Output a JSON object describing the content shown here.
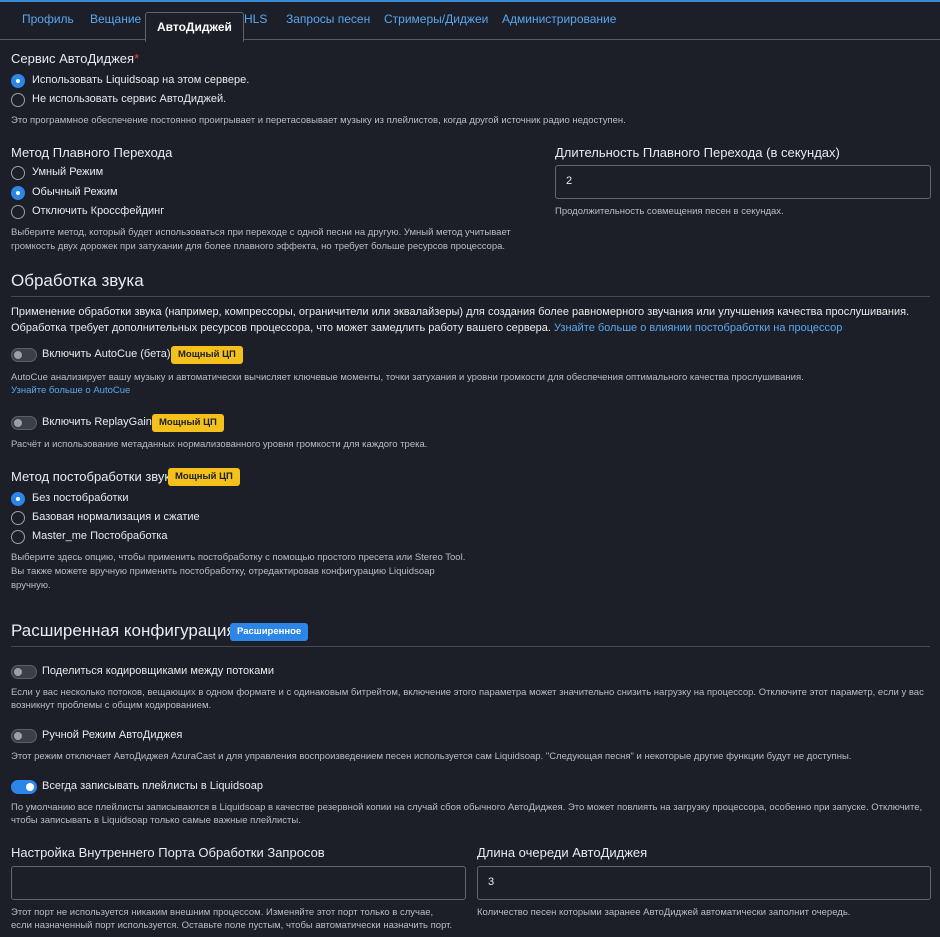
{
  "tabs": [
    "Профиль",
    "Вещание",
    "АвтоДиджей",
    "HLS",
    "Запросы песен",
    "Стримеры/Диджеи",
    "Администрирование"
  ],
  "autodj_service": {
    "label": "Сервис АвтоДиджея",
    "required_mark": "*",
    "options": [
      "Использовать Liquidsoap на этом сервере.",
      "Не использовать сервис АвтоДиджей."
    ],
    "selected": 0,
    "help": "Это программное обеспечение постоянно проигрывает и перетасовывает музыку из плейлистов, когда другой источник радио недоступен."
  },
  "crossfade_method": {
    "label": "Метод Плавного Перехода",
    "options": [
      "Умный Режим",
      "Обычный Режим",
      "Отключить Кроссфейдинг"
    ],
    "selected": 1,
    "help_line1": "Выберите метод, который будет использоваться при переходе с одной песни на другую. Умный метод учитывает",
    "help_line2": "громкость двух дорожек при затухании для более плавного эффекта, но требует больше ресурсов процессора."
  },
  "crossfade_duration": {
    "label": "Длительность Плавного Перехода (в секундах)",
    "value": "2",
    "help": "Продолжительность совмещения песен в секундах."
  },
  "audio_processing": {
    "heading": "Обработка звука",
    "intro_line1": "Применение обработки звука (например, компрессоры, ограничители или эквалайзеры) для создания более равномерного звучания или улучшения качества прослушивания.",
    "intro_line2": "Обработка требует дополнительных ресурсов процессора, что может замедлить работу вашего сервера.",
    "intro_link": "Узнайте больше о влиянии постобработки на процессор",
    "autocue": {
      "label": "Включить AutoCue (бета)",
      "badge": "Мощный ЦП",
      "enabled": false,
      "help": "AutoCue анализирует вашу музыку и автоматически вычисляет ключевые моменты, точки затухания и уровни громкости для обеспечения оптимального качества прослушивания.",
      "link": "Узнайте больше о AutoCue"
    },
    "replaygain": {
      "label": "Включить ReplayGain",
      "badge": "Мощный ЦП",
      "enabled": false,
      "help": "Расчёт и использование метаданных нормализованного уровня громкости для каждого трека."
    },
    "postprocessing": {
      "label": "Метод постобработки звука",
      "badge": "Мощный ЦП",
      "options": [
        "Без постобработки",
        "Базовая нормализация и сжатие",
        "Master_me Постобработка"
      ],
      "selected": 0,
      "help_line1": "Выберите здесь опцию, чтобы применить постобработку с помощью простого пресета или Stereo Tool.",
      "help_line2": "Вы также можете вручную применить постобработку, отредактировав конфигурацию Liquidsoap",
      "help_line3": "вручную."
    }
  },
  "advanced": {
    "heading": "Расширенная конфигурация",
    "badge": "Расширенное",
    "share_encoders": {
      "label": "Поделиться кодировщиками между потоками",
      "enabled": false,
      "help_line1": "Если у вас несколько потоков, вещающих в одном формате и с одинаковым битрейтом, включение этого параметра может значительно снизить нагрузку на процессор. Отключите этот параметр, если у вас",
      "help_line2": "возникнут проблемы с общим кодированием."
    },
    "manual_autodj": {
      "label": "Ручной Режим АвтоДиджея",
      "enabled": false,
      "help": "Этот режим отключает АвтоДиджея AzuraCast и для управления воспроизведением песен используется сам Liquidsoap. \"Следующая песня\" и некоторые другие функции будут не доступны."
    },
    "write_playlists": {
      "label": "Всегда записывать плейлисты в Liquidsoap",
      "enabled": true,
      "help_line1": "По умолчанию все плейлисты записываются в Liquidsoap в качестве резервной копии на случай сбоя обычного АвтоДиджея. Это может повлиять на загрузку процессора, особенно при запуске. Отключите,",
      "help_line2": "чтобы записывать в Liquidsoap только самые важные плейлисты."
    },
    "request_port": {
      "label": "Настройка Внутреннего Порта Обработки Запросов",
      "value": "",
      "help_line1": "Этот порт не используется никаким внешним процессом. Изменяйте этот порт только в случае,",
      "help_line2": "если назначенный порт используется. Оставьте поле пустым, чтобы автоматически назначить порт."
    },
    "queue_length": {
      "label": "Длина очереди АвтоДиджея",
      "value": "3",
      "help": "Количество песен которыми заранее АвтоДиджей автоматически заполнит очередь."
    }
  },
  "colors": {
    "background": "#1c1f27",
    "accent": "#2c86e8",
    "link": "#5aa7f0",
    "badge_warning": "#f3c01c",
    "required": "#e0453c"
  }
}
